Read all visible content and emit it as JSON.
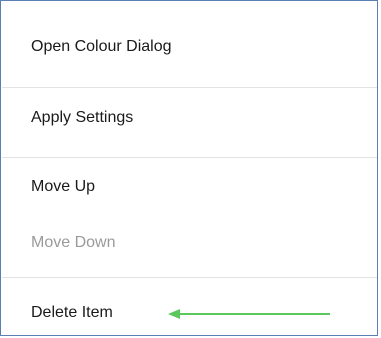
{
  "menu": {
    "items": [
      {
        "label": "Open Colour Dialog",
        "enabled": true
      },
      {
        "label": "Apply Settings",
        "enabled": true
      },
      {
        "label": "Move Up",
        "enabled": true
      },
      {
        "label": "Move Down",
        "enabled": false
      },
      {
        "label": "Delete Item",
        "enabled": true
      }
    ]
  },
  "colors": {
    "border": "#5b7fb5",
    "separator": "#e3e3e3",
    "text": "#1a1a1a",
    "disabled_text": "#9a9a9a",
    "arrow": "#5ac85a"
  },
  "annotation": {
    "icon": "arrow-left-icon",
    "points_to": "Delete Item"
  }
}
